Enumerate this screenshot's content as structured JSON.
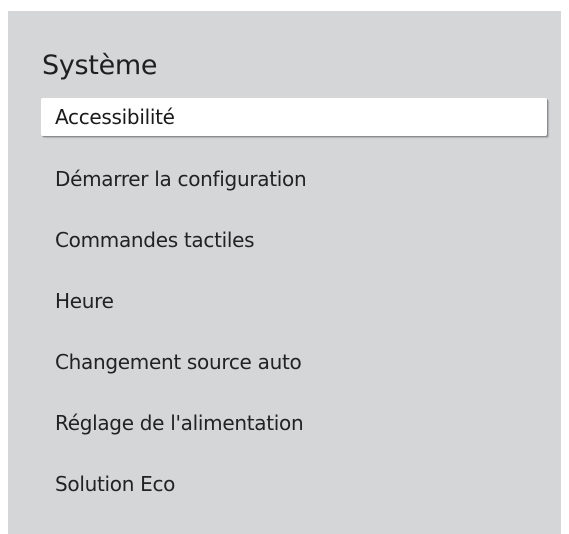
{
  "menu": {
    "title": "Système",
    "items": [
      {
        "label": "Accessibilité",
        "selected": true
      },
      {
        "label": "Démarrer la configuration",
        "selected": false
      },
      {
        "label": "Commandes tactiles",
        "selected": false
      },
      {
        "label": "Heure",
        "selected": false
      },
      {
        "label": "Changement source auto",
        "selected": false
      },
      {
        "label": "Réglage de l'alimentation",
        "selected": false
      },
      {
        "label": "Solution Eco",
        "selected": false
      }
    ]
  },
  "colors": {
    "panel_background": "#d5d6d8",
    "selected_background": "#ffffff",
    "text": "#222222"
  }
}
